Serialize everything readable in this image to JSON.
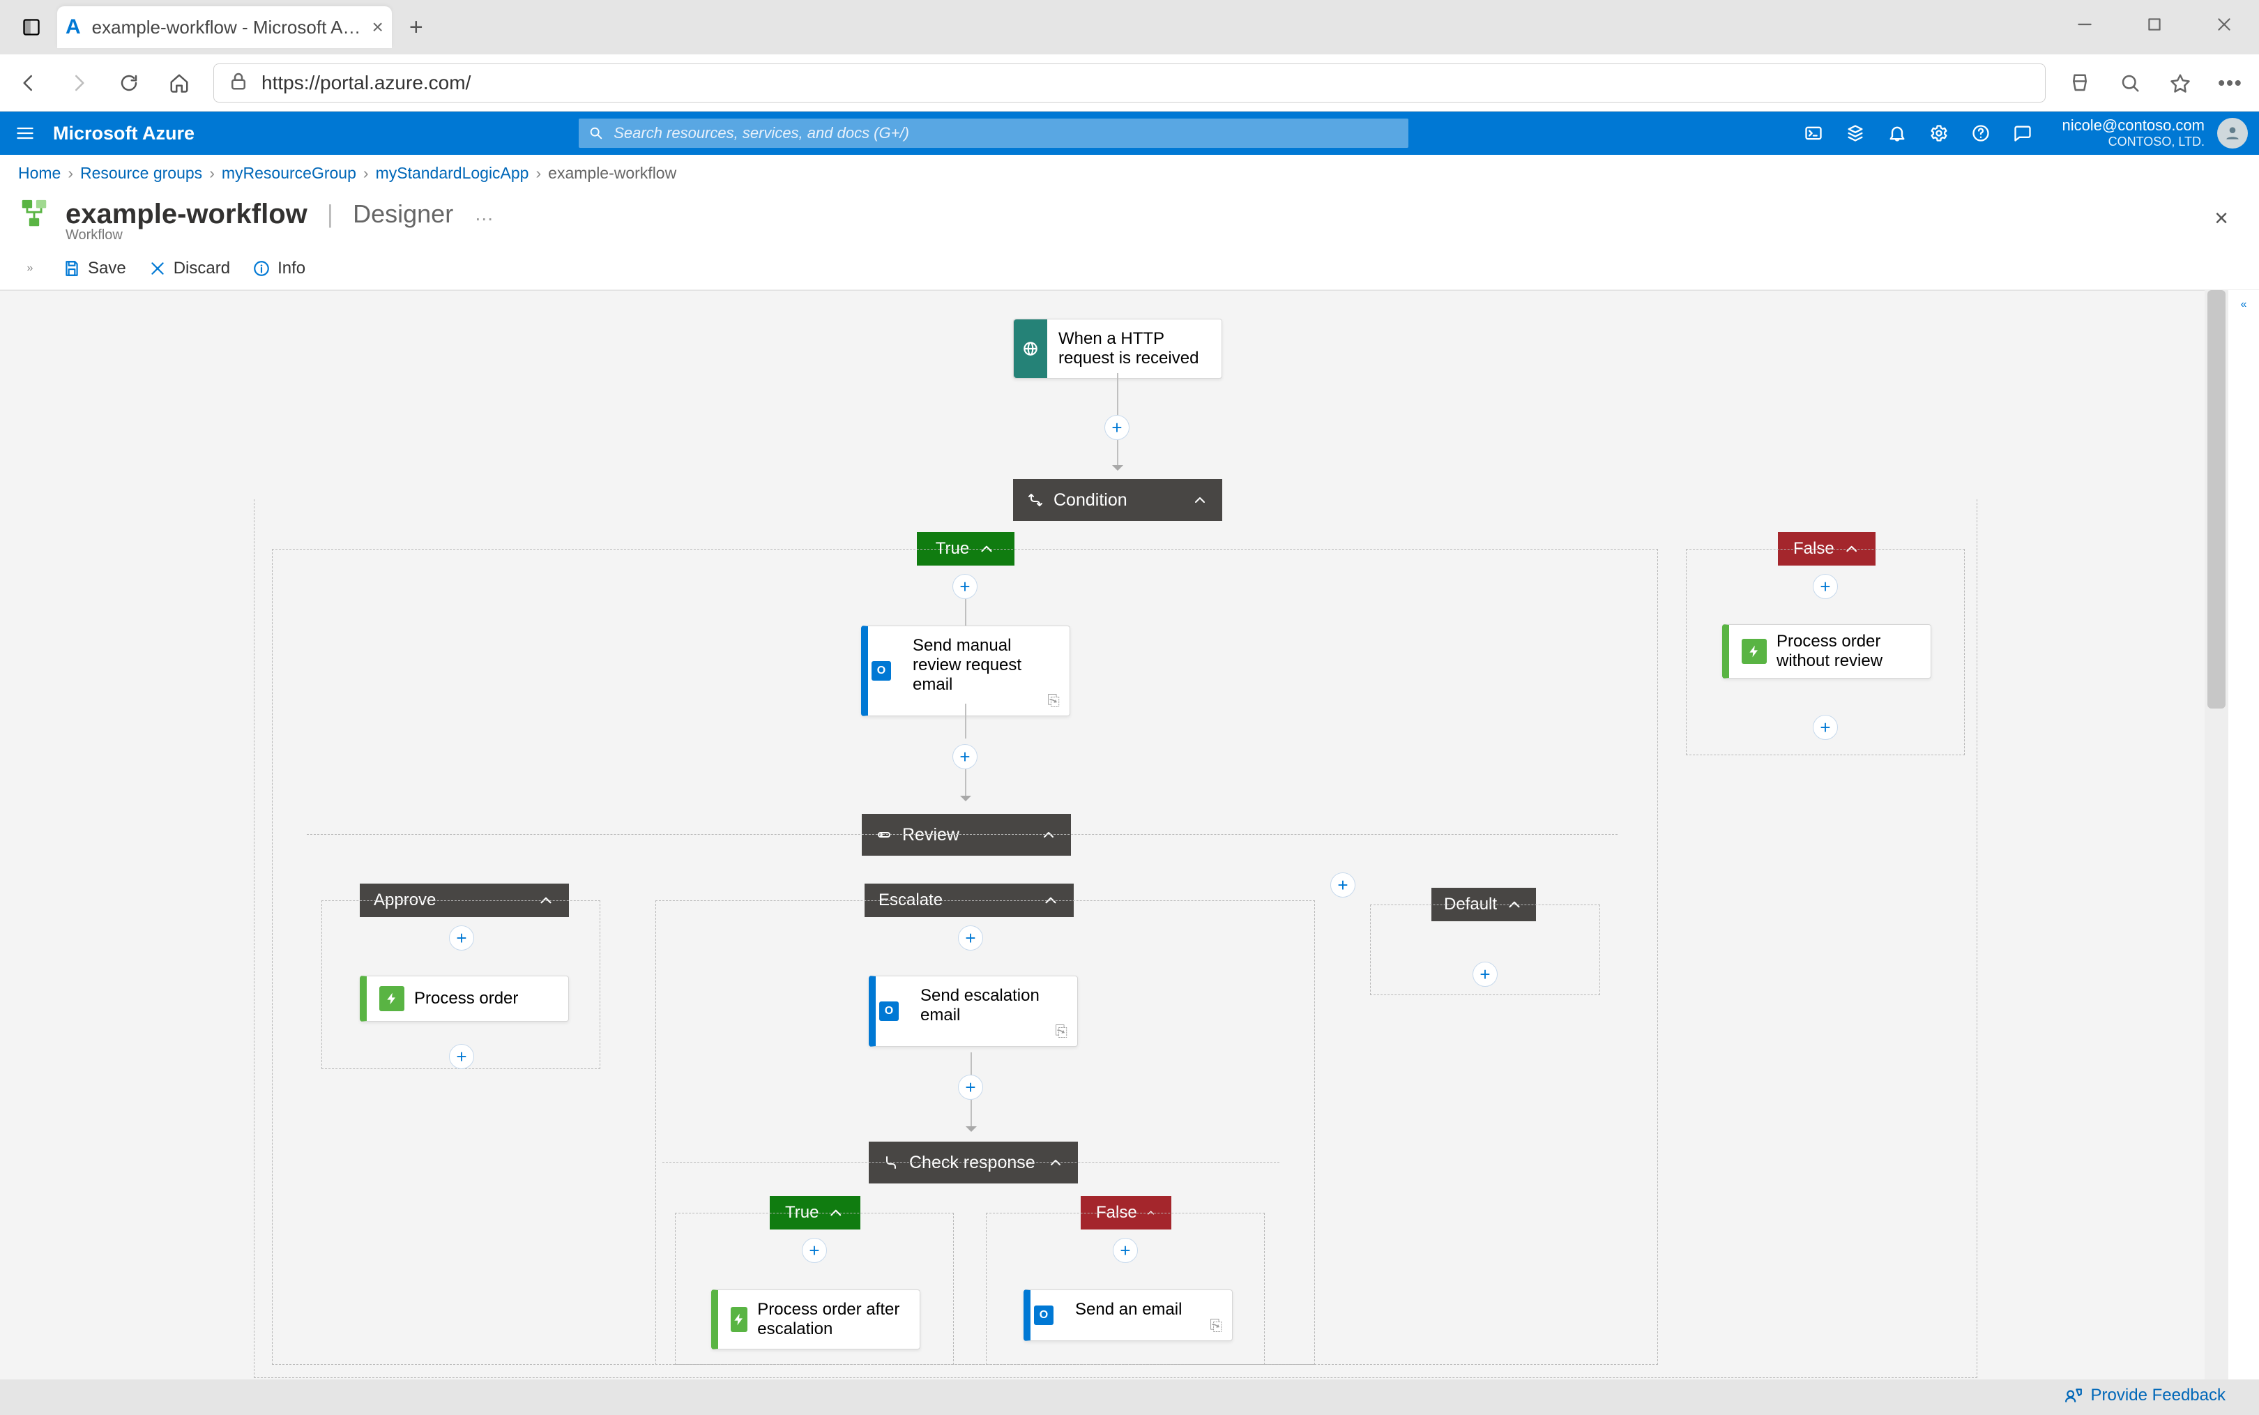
{
  "browser": {
    "tab_title": "example-workflow - Microsoft A…",
    "url": "https://portal.azure.com/"
  },
  "azure_top": {
    "brand": "Microsoft Azure",
    "search_placeholder": "Search resources, services, and docs (G+/)",
    "account_email": "nicole@contoso.com",
    "account_org": "CONTOSO, LTD."
  },
  "breadcrumb": [
    "Home",
    "Resource groups",
    "myResourceGroup",
    "myStandardLogicApp",
    "example-workflow"
  ],
  "blade": {
    "title": "example-workflow",
    "mode": "Designer",
    "subtitle": "Workflow"
  },
  "toolbar": {
    "save": "Save",
    "discard": "Discard",
    "info": "Info"
  },
  "designer": {
    "trigger": "When a HTTP request is received",
    "condition_label": "Condition",
    "true_label": "True",
    "false_label": "False",
    "send_review_email": "Send manual review request email",
    "process_without_review": "Process order without review",
    "switch_review": "Review",
    "case_approve": "Approve",
    "case_escalate": "Escalate",
    "case_default": "Default",
    "process_order": "Process order",
    "send_escalation_email": "Send escalation email",
    "check_response": "Check response",
    "process_after_escalation": "Process order after escalation",
    "send_an_email": "Send an email"
  },
  "footer": {
    "provide_feedback": "Provide Feedback"
  }
}
